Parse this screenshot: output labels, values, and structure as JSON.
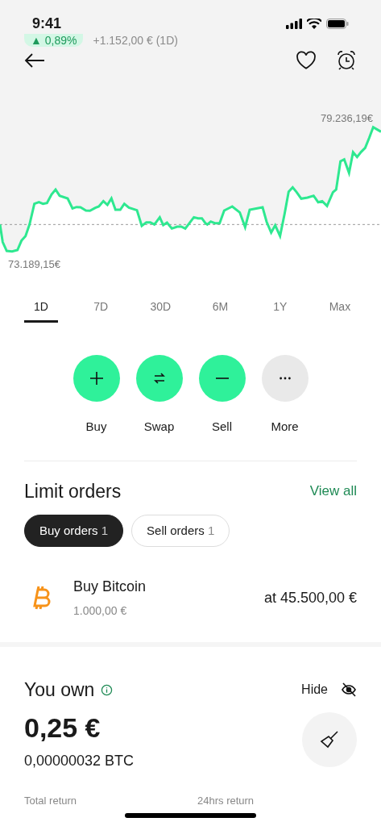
{
  "status_bar": {
    "time": "9:41"
  },
  "price_change": {
    "percent": "▲ 0,89%",
    "amount": "+1.152,00 € (1D)"
  },
  "chart": {
    "high_label": "79.236,19€",
    "low_label": "73.189,15€"
  },
  "periods": [
    {
      "label": "1D",
      "selected": true
    },
    {
      "label": "7D",
      "selected": false
    },
    {
      "label": "30D",
      "selected": false
    },
    {
      "label": "6M",
      "selected": false
    },
    {
      "label": "1Y",
      "selected": false
    },
    {
      "label": "Max",
      "selected": false
    }
  ],
  "actions": [
    {
      "kind": "buy",
      "label": "Buy"
    },
    {
      "kind": "swap",
      "label": "Swap"
    },
    {
      "kind": "sell",
      "label": "Sell"
    },
    {
      "kind": "more",
      "label": "More"
    }
  ],
  "limit_orders": {
    "title": "Limit orders",
    "view_all": "View all",
    "filters": [
      {
        "label": "Buy orders",
        "count": "1",
        "selected": true
      },
      {
        "label": "Sell orders",
        "count": "1",
        "selected": false
      }
    ],
    "orders": [
      {
        "title": "Buy Bitcoin",
        "amount": "1.000,00 €",
        "price": "at 45.500,00 €"
      }
    ]
  },
  "holdings": {
    "title": "You own",
    "hide": "Hide",
    "value": "0,25 €",
    "crypto": "0,00000032 BTC",
    "total_return": "Total return",
    "day_return": "24hrs return"
  }
}
